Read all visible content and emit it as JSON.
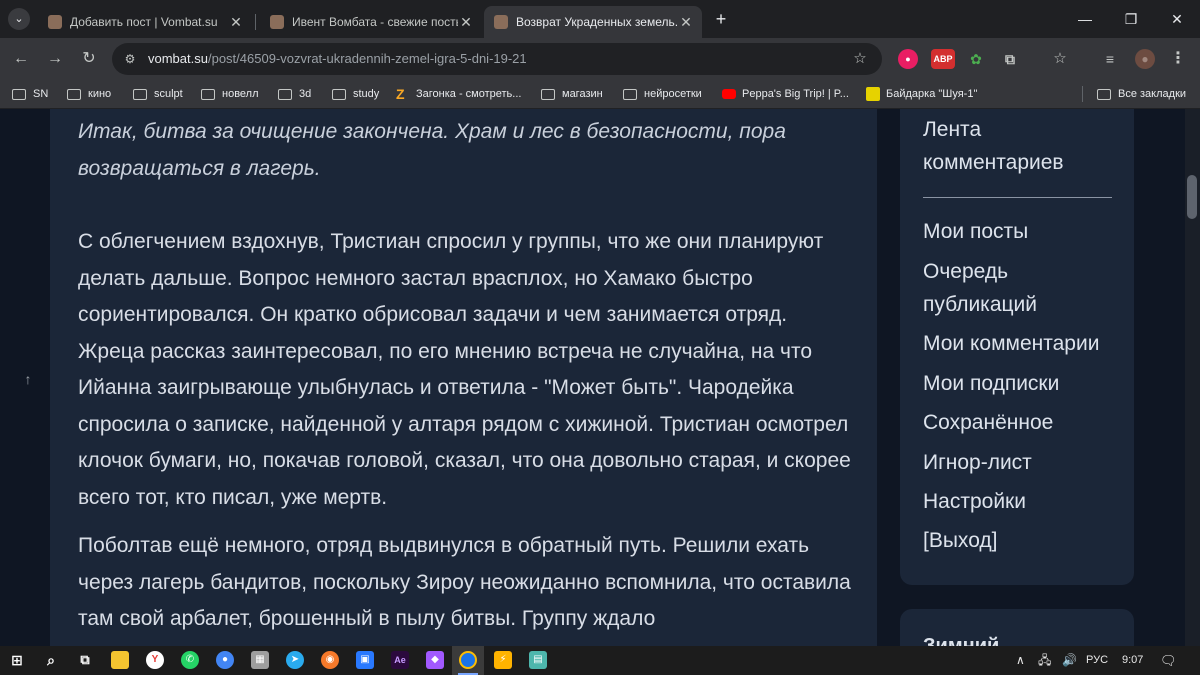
{
  "browser": {
    "tabs": [
      {
        "title": "Добавить пост | Vombat.su",
        "active": false
      },
      {
        "title": "Ивент Вомбата - свежие посты",
        "active": false
      },
      {
        "title": "Возврат Украденных земель. И",
        "active": true
      }
    ],
    "new_tab_glyph": "+",
    "window_controls": {
      "minimize": "—",
      "restore": "❐",
      "close": "✕"
    },
    "nav": {
      "back": "←",
      "forward": "→",
      "reload": "↻"
    },
    "url_host": "vombat.su",
    "url_path": "/post/46509-vozvrat-ukradennih-zemel-igra-5-dni-19-21",
    "extensions": [
      {
        "name": "record-icon",
        "label": "●",
        "color": "#e91e63"
      },
      {
        "name": "adblock-icon",
        "label": "ABP",
        "color": "#d32f2f"
      },
      {
        "name": "palette-icon",
        "label": "✿",
        "color": "#4caf50"
      },
      {
        "name": "puzzle-icon",
        "label": "⧉",
        "color": "#5f6368"
      },
      {
        "name": "bookmark-star-icon",
        "label": "☆",
        "color": "#5f6368"
      },
      {
        "name": "media-icon",
        "label": "≡",
        "color": "#5f6368"
      },
      {
        "name": "profile-avatar",
        "label": "●",
        "color": "#6d4c41"
      },
      {
        "name": "menu-icon",
        "label": "⋮",
        "color": "#5f6368"
      }
    ],
    "bookmarks": [
      {
        "label": "SN",
        "icon": "folder"
      },
      {
        "label": "кино",
        "icon": "folder"
      },
      {
        "label": "sculpt",
        "icon": "folder"
      },
      {
        "label": "новелл",
        "icon": "folder"
      },
      {
        "label": "3d",
        "icon": "folder"
      },
      {
        "label": "study",
        "icon": "folder"
      },
      {
        "label": "Загонка - смотреть...",
        "icon": "zagonka"
      },
      {
        "label": "магазин",
        "icon": "folder"
      },
      {
        "label": "нейросетки",
        "icon": "folder"
      },
      {
        "label": "Peppa's Big Trip! | P...",
        "icon": "youtube"
      },
      {
        "label": "Байдарка \"Шуя-1\"",
        "icon": "green"
      }
    ],
    "all_bookmarks": "Все закладки"
  },
  "article": {
    "p1": "Итак, битва за очищение закончена. Храм и лес в безопасности, пора возвращаться в лагерь.",
    "p2": "С облегчением вздохнув, Тристиан спросил у группы, что же они планируют делать дальше. Вопрос немного застал врасплох, но Хамако быстро сориентировался. Он кратко обрисовал задачи и чем занимается отряд. Жреца рассказ заинтересовал, по его мнению встреча не случайна, на что Ийанна заигрывающе улыбнулась и ответила - \"Может быть\". Чародейка спросила о записке, найденной у алтаря рядом с хижиной. Тристиан осмотрел клочок бумаги, но, покачав головой, сказал, что она довольно старая, и скорее всего тот, кто писал, уже мертв.",
    "p3": "Поболтав ещё немного, отряд выдвинулся в обратный путь. Решили ехать через лагерь бандитов, поскольку Зироу неожиданно вспомнила, что оставила там свой арбалет, брошенный в пылу битвы. Группу ждало"
  },
  "sidebar": {
    "feed": "Лента комментариев",
    "links": [
      "Мои посты",
      "Очередь публикаций",
      "Мои комментарии",
      "Мои подписки",
      "Сохранённое",
      "Игнор-лист",
      "Настройки",
      "[Выход]"
    ],
    "widget_title": "Зимний"
  },
  "scroll_top": "↑",
  "taskbar": {
    "lang": "РУС",
    "time": "9:07",
    "tray_chevron": "∧",
    "notify": "🗨"
  }
}
